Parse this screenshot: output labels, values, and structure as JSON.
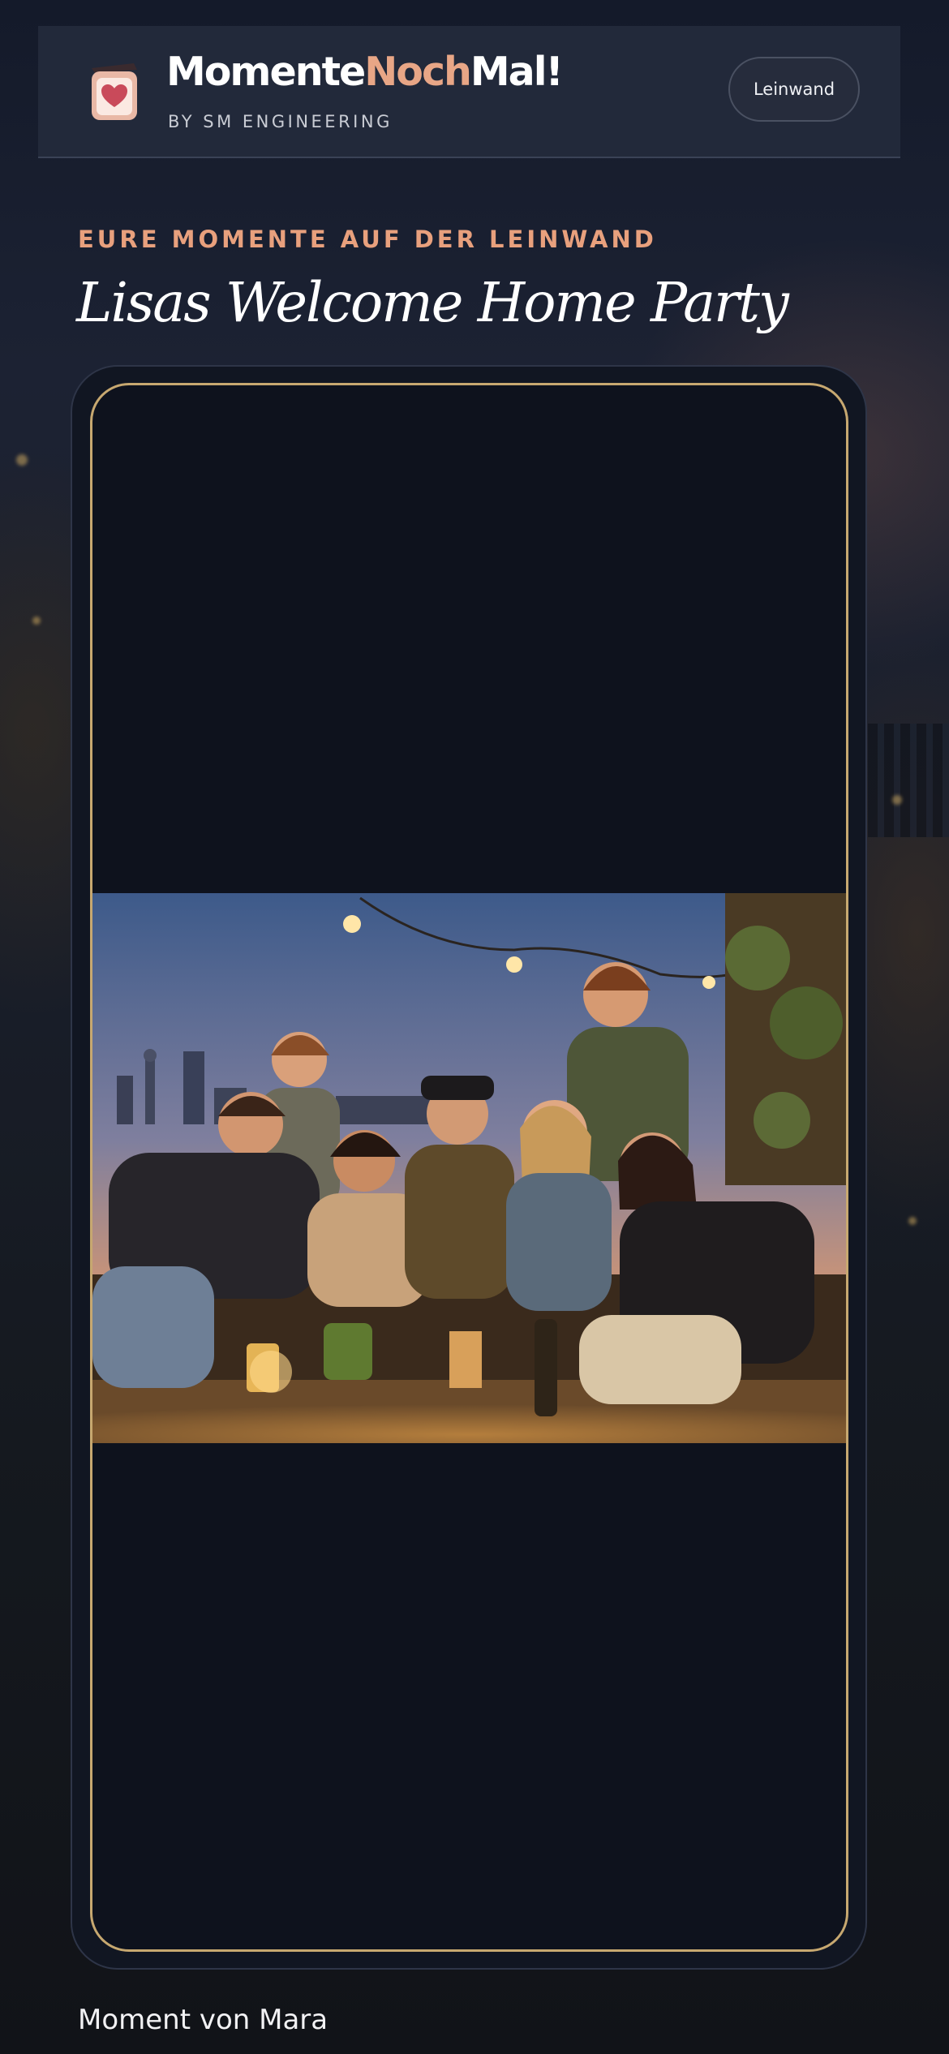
{
  "header": {
    "brand_part1": "Momente",
    "brand_part2": "Noch",
    "brand_part3": "Mal!",
    "byline": "BY SM ENGINEERING",
    "leinwand_label": "Leinwand",
    "logo_icon": "heart-card-icon"
  },
  "event": {
    "kicker": "EURE MOMENTE AUF DER LEINWAND",
    "title": "Lisas Welcome Home Party"
  },
  "moment": {
    "caption": "Moment von Mara"
  },
  "colors": {
    "accent": "#e8a686",
    "kicker": "#e8a07d",
    "frame_border": "#c7a870",
    "background": "#121826"
  }
}
